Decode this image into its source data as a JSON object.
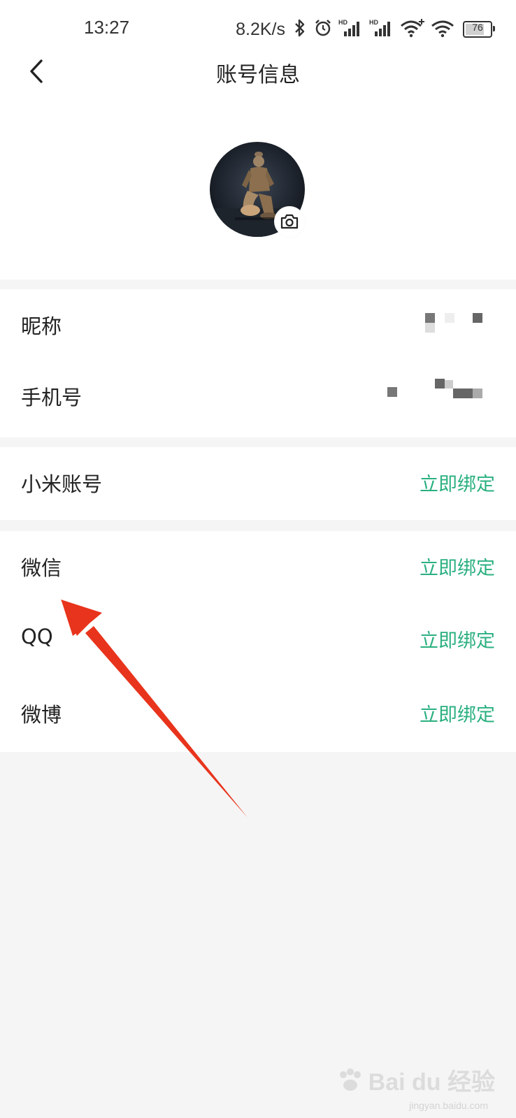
{
  "status_bar": {
    "time": "13:27",
    "net_speed": "8.2K/s",
    "battery": "76",
    "battery_level": 0.76,
    "icons": [
      "bluetooth-icon",
      "alarm-icon",
      "hd-signal-icon",
      "hd-signal-icon",
      "wifi-plus-icon",
      "wifi-icon",
      "battery-icon"
    ]
  },
  "header": {
    "title": "账号信息",
    "back_icon": "chevron-left-icon"
  },
  "avatar": {
    "camera_icon": "camera-icon"
  },
  "profile": {
    "nickname_label": "昵称",
    "phone_label": "手机号"
  },
  "bindings": {
    "xiaomi": {
      "label": "小米账号",
      "action": "立即绑定"
    },
    "wechat": {
      "label": "微信",
      "action": "立即绑定"
    },
    "qq": {
      "label": "QQ",
      "action": "立即绑定"
    },
    "weibo": {
      "label": "微博",
      "action": "立即绑定"
    }
  },
  "colors": {
    "accent": "#2ab07f",
    "annotation": "#e8341c",
    "background": "#f5f5f5"
  },
  "watermark": {
    "text": "Bai du 经验",
    "sub": "jingyan.baidu.com"
  }
}
